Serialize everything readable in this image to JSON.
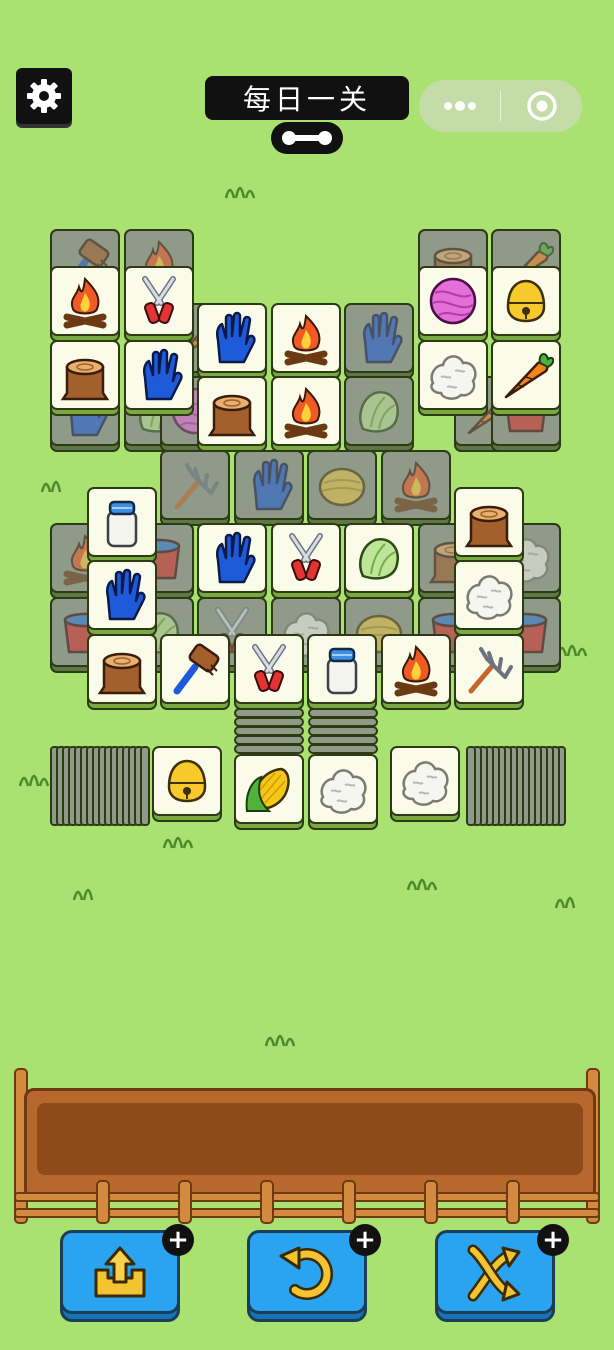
{
  "header": {
    "title": "每日一关",
    "settings_icon": "gear-icon",
    "more_icon": "more-dots-icon",
    "close_icon": "target-circle-icon"
  },
  "board": {
    "top_layer": [
      {
        "col": 0,
        "row": 0,
        "item": "campfire"
      },
      {
        "col": 1,
        "row": 0,
        "item": "shears"
      },
      {
        "col": 0,
        "row": 1,
        "item": "stump"
      },
      {
        "col": 1,
        "row": 1,
        "item": "glove"
      },
      {
        "col": 2,
        "row": 0.5,
        "item": "glove"
      },
      {
        "col": 3,
        "row": 0.5,
        "item": "campfire"
      },
      {
        "col": 2,
        "row": 1.5,
        "item": "stump"
      },
      {
        "col": 3,
        "row": 1.5,
        "item": "campfire"
      },
      {
        "col": 5,
        "row": 0,
        "item": "yarn"
      },
      {
        "col": 6,
        "row": 0,
        "item": "bell"
      },
      {
        "col": 5,
        "row": 1,
        "item": "rice"
      },
      {
        "col": 6,
        "row": 1,
        "item": "carrot"
      },
      {
        "col": 0.5,
        "row": 3,
        "item": "milk"
      },
      {
        "col": 0.5,
        "row": 4,
        "item": "glove"
      },
      {
        "col": 2,
        "row": 3.5,
        "item": "glove"
      },
      {
        "col": 3,
        "row": 3.5,
        "item": "shears"
      },
      {
        "col": 4,
        "row": 3.5,
        "item": "cabbage"
      },
      {
        "col": 5.5,
        "row": 3,
        "item": "stump"
      },
      {
        "col": 5.5,
        "row": 4,
        "item": "rice"
      },
      {
        "col": 0.5,
        "row": 5,
        "item": "stump"
      },
      {
        "col": 1.5,
        "row": 5,
        "item": "brush"
      },
      {
        "col": 2.5,
        "row": 5,
        "item": "shears"
      },
      {
        "col": 3.5,
        "row": 5,
        "item": "milk"
      },
      {
        "col": 4.5,
        "row": 5,
        "item": "campfire"
      },
      {
        "col": 5.5,
        "row": 5,
        "item": "pitchfork"
      }
    ],
    "under_layer": [
      {
        "col": 0,
        "row": -0.5,
        "item": "brush"
      },
      {
        "col": 1,
        "row": -0.5,
        "item": "campfire"
      },
      {
        "col": 5,
        "row": -0.5,
        "item": "stump"
      },
      {
        "col": 6,
        "row": -0.5,
        "item": "carrot"
      },
      {
        "col": 0,
        "row": 1.5,
        "item": "glove"
      },
      {
        "col": 1,
        "row": 1.5,
        "item": "cabbage"
      },
      {
        "col": 1.5,
        "row": 0.5,
        "item": "carrot"
      },
      {
        "col": 1.5,
        "row": 1.5,
        "item": "yarn"
      },
      {
        "col": 4,
        "row": 0.5,
        "item": "glove"
      },
      {
        "col": 4,
        "row": 1.5,
        "item": "cabbage"
      },
      {
        "col": 5.5,
        "row": 1.5,
        "item": "carrot"
      },
      {
        "col": 6,
        "row": 1.5,
        "item": "bucket"
      },
      {
        "col": 1.5,
        "row": 2.5,
        "item": "pitchfork"
      },
      {
        "col": 2.5,
        "row": 2.5,
        "item": "glove"
      },
      {
        "col": 3.5,
        "row": 2.5,
        "item": "hay"
      },
      {
        "col": 4.5,
        "row": 2.5,
        "item": "campfire"
      },
      {
        "col": 0,
        "row": 3.5,
        "item": "campfire"
      },
      {
        "col": 1,
        "row": 3.5,
        "item": "bucket"
      },
      {
        "col": 5,
        "row": 3.5,
        "item": "stump"
      },
      {
        "col": 6,
        "row": 3.5,
        "item": "rice"
      },
      {
        "col": 0,
        "row": 4.5,
        "item": "bucket"
      },
      {
        "col": 1,
        "row": 4.5,
        "item": "cabbage"
      },
      {
        "col": 2,
        "row": 4.5,
        "item": "shears"
      },
      {
        "col": 3,
        "row": 4.5,
        "item": "rice"
      },
      {
        "col": 4,
        "row": 4.5,
        "item": "hay"
      },
      {
        "col": 5,
        "row": 4.5,
        "item": "bucket"
      },
      {
        "col": 6,
        "row": 4.5,
        "item": "bucket"
      }
    ]
  },
  "stacks": {
    "left_top": "bell",
    "middle": [
      "corn",
      "rice"
    ],
    "right_top": "rice"
  },
  "tray": {
    "slots": [],
    "capacity": 7
  },
  "powerups": [
    {
      "name": "move-out",
      "icon": "move-out-icon"
    },
    {
      "name": "undo",
      "icon": "undo-icon"
    },
    {
      "name": "shuffle",
      "icon": "shuffle-icon"
    }
  ],
  "colors": {
    "background": "#a9e271",
    "tile_face": "#fbfbe9",
    "tile_base": "#79a941",
    "button": "#2aa3f0",
    "tray": "#b7682c"
  }
}
